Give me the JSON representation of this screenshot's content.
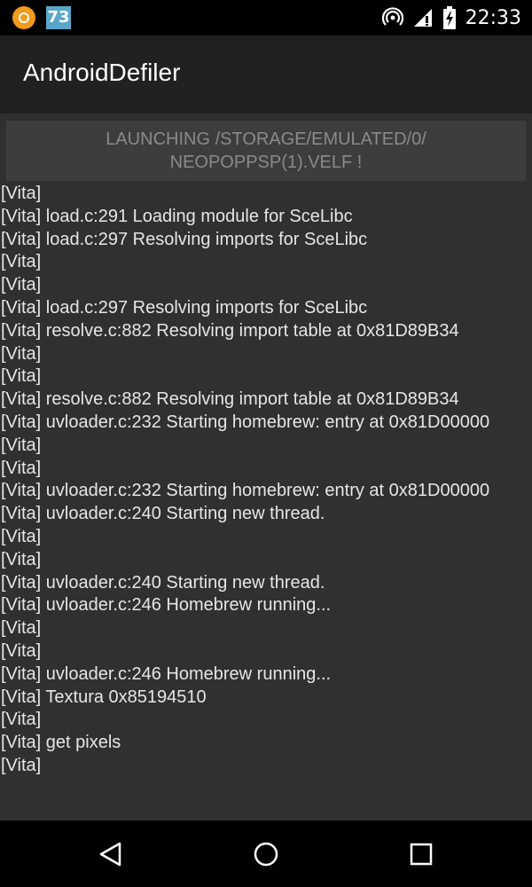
{
  "status_bar": {
    "notification_badge": "73",
    "time": "22:33"
  },
  "app_bar": {
    "title": "AndroidDefiler"
  },
  "launch_button": {
    "label": "LAUNCHING /STORAGE/EMULATED/0/ NEOPOPPSP(1).VELF !"
  },
  "log": {
    "lines": [
      "[Vita]",
      "[Vita] load.c:291 Loading module for SceLibc",
      "[Vita] load.c:297 Resolving imports for SceLibc",
      "[Vita]",
      "[Vita]",
      "[Vita] load.c:297 Resolving imports for SceLibc",
      "[Vita] resolve.c:882 Resolving import table at 0x81D89B34",
      "[Vita]",
      "[Vita]",
      "[Vita] resolve.c:882 Resolving import table at 0x81D89B34",
      "[Vita] uvloader.c:232 Starting homebrew: entry at 0x81D00000",
      "[Vita]",
      "[Vita]",
      "[Vita] uvloader.c:232 Starting homebrew: entry at 0x81D00000",
      "[Vita] uvloader.c:240 Starting new thread.",
      "[Vita]",
      "[Vita]",
      "[Vita] uvloader.c:240 Starting new thread.",
      "[Vita] uvloader.c:246 Homebrew running...",
      "[Vita]",
      "[Vita]",
      "[Vita] uvloader.c:246 Homebrew running...",
      "[Vita] Textura 0x85194510",
      "[Vita]",
      "[Vita] get pixels",
      "[Vita]"
    ]
  },
  "nav_bar": {
    "back": "back-icon",
    "home": "home-icon",
    "recents": "recents-icon"
  }
}
